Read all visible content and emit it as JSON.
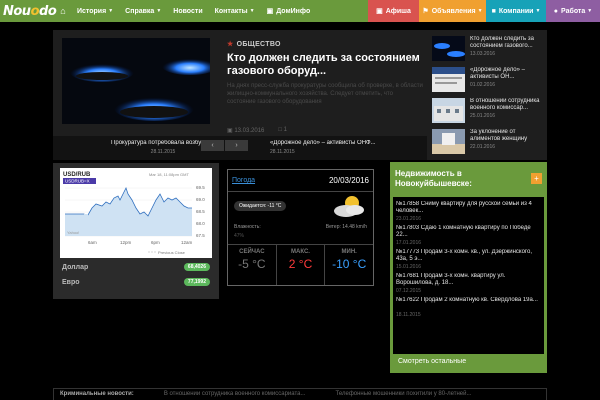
{
  "nav": {
    "logo": "Nou",
    "logo_o": "o",
    "logo_suffix": "do",
    "home_icon": "home-icon",
    "items": [
      {
        "label": "История",
        "caret": "▼"
      },
      {
        "label": "Справка",
        "caret": "▼"
      },
      {
        "label": "Новости",
        "caret": ""
      },
      {
        "label": "Контакты",
        "caret": "▼"
      },
      {
        "label": "ДомИнфо",
        "caret": ""
      }
    ],
    "categories": [
      {
        "label": "Афиша",
        "color": "#d9534f"
      },
      {
        "label": "Объявления",
        "color": "#f0a030"
      },
      {
        "label": "Компании",
        "color": "#17a2b8"
      },
      {
        "label": "Работа",
        "color": "#8e5ea2"
      }
    ]
  },
  "hero": {
    "category": "ОБЩЕСТВО",
    "title": "Кто должен следить за состоянием газового оборуд...",
    "excerpt": "На днях пресс-служба прокуратуры сообщила об проверке, в области жилищно-коммунального хозяйства. Следует отметить, что состояние газового оборудования",
    "date": "13.03.2016",
    "comments": "1"
  },
  "thumbs": [
    {
      "title": "Кто должен следить за состоянием газового...",
      "date": "13.03.2016"
    },
    {
      "title": "«Дорожное дело» – активисты ОН...",
      "date": "01.02.2016"
    },
    {
      "title": "В отношении сотрудника военного комиссар...",
      "date": "25.01.2016"
    },
    {
      "title": "За уклонение от алиментов женщину осудили",
      "date": "22.01.2016"
    }
  ],
  "captions": [
    {
      "title": "Прокуратура потребовала возбудит...",
      "date": "28.11.2015"
    },
    {
      "title": "«Дорожное дело» – активисты ОНФ...",
      "date": "28.11.2015"
    }
  ],
  "currency": {
    "pair": "USD/RUB",
    "ticker": "USDRUB=X",
    "time": "Mar 18, 11:08pm GMT",
    "y_ticks": [
      "69.5",
      "69.0",
      "68.5",
      "68.0",
      "67.5"
    ],
    "x_ticks": [
      "6am",
      "12pm",
      "6pm",
      "12am"
    ],
    "legend": "Previous Close",
    "watermark": "Yahoo!",
    "rates": [
      {
        "label": "Доллар",
        "value": "68,4026"
      },
      {
        "label": "Евро",
        "value": "77,1992"
      }
    ]
  },
  "weather": {
    "link": "Погода",
    "date": "20/03/2016",
    "expected": "Ожидается: -11 °C",
    "humidity_label": "Влажность:",
    "humidity": "47%",
    "wind": "Ветер: 14.48 km/h",
    "cells": [
      {
        "label": "СЕЙЧАС",
        "value": "-5 °C",
        "color": "#777777"
      },
      {
        "label": "МАКС.",
        "value": "2 °C",
        "color": "#ff3b3b"
      },
      {
        "label": "МИН.",
        "value": "-10 °C",
        "color": "#3aa0ff"
      }
    ]
  },
  "realty": {
    "heading": "Недвижимость в Новокуйбышевске:",
    "plus": "+",
    "items": [
      {
        "title": "№17858 Сниму квартиру для русской семьи из 4 человек...",
        "date": "23.01.2016"
      },
      {
        "title": "№17803 Сдаю 1 комнатную квартиру по Победе 22...",
        "date": "17.01.2016"
      },
      {
        "title": "№17773 Продам 3-х комн. кв., ул. Дзержинского, 43а, 5 э...",
        "date": "15.01.2016"
      },
      {
        "title": "№17681 Продам 3-х комн. квартиру ул. Ворошилова, д. 18...",
        "date": "07.12.2015"
      },
      {
        "title": "№17622 Продам 2 комнатную кв. Свердлова 19а...",
        "date": "18.11.2015"
      }
    ],
    "more": "Смотреть остальные"
  },
  "bottom": {
    "heading": "Криминальные новости:",
    "items": [
      "В отношении сотрудника военного комиссариата...",
      "Телефонные мошенники похитили у 80-летней..."
    ]
  }
}
